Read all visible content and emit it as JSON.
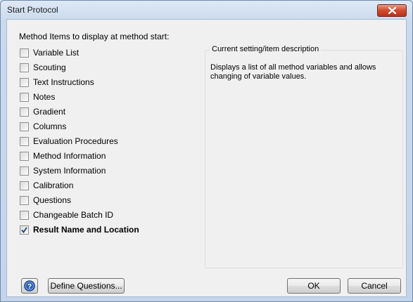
{
  "window": {
    "title": "Start Protocol"
  },
  "method_items": {
    "label": "Method Items to display at method start:",
    "items": [
      {
        "label": "Variable List",
        "checked": false
      },
      {
        "label": "Scouting",
        "checked": false
      },
      {
        "label": "Text Instructions",
        "checked": false
      },
      {
        "label": "Notes",
        "checked": false
      },
      {
        "label": "Gradient",
        "checked": false
      },
      {
        "label": "Columns",
        "checked": false
      },
      {
        "label": "Evaluation Procedures",
        "checked": false
      },
      {
        "label": "Method Information",
        "checked": false
      },
      {
        "label": "System Information",
        "checked": false
      },
      {
        "label": "Calibration",
        "checked": false
      },
      {
        "label": "Questions",
        "checked": false
      },
      {
        "label": "Changeable Batch ID",
        "checked": false
      },
      {
        "label": "Result Name and Location",
        "checked": true
      }
    ]
  },
  "description": {
    "title": "Current setting/item description",
    "text": "Displays a list of all method variables and allows changing of variable values."
  },
  "buttons": {
    "help_icon": "help-icon",
    "define_questions": "Define Questions...",
    "ok": "OK",
    "cancel": "Cancel"
  },
  "colors": {
    "close_button": "#cf4a2e",
    "help_icon": "#2b5fb4",
    "check_mark": "#1f3f8a"
  }
}
